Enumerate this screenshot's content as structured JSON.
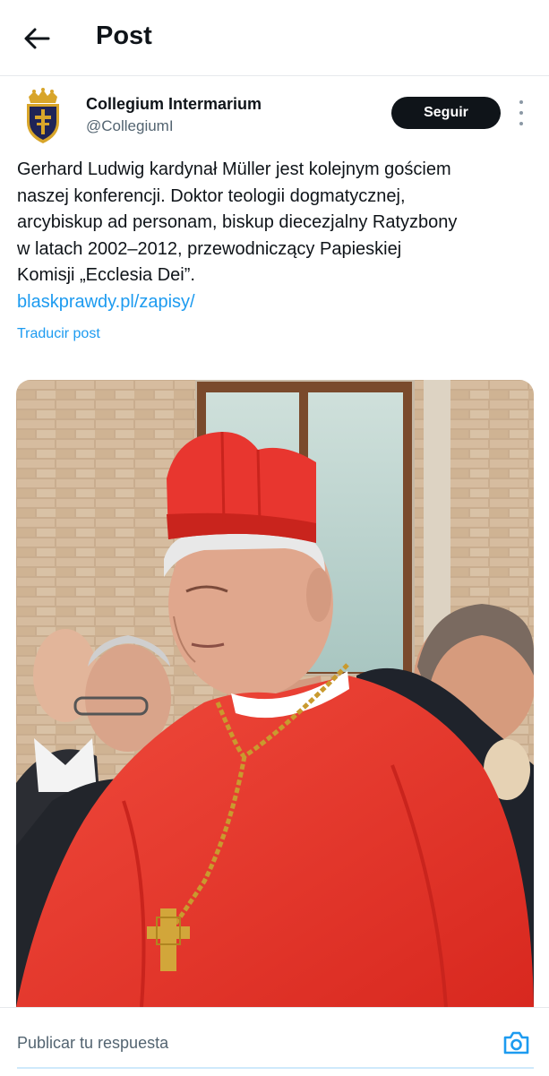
{
  "header": {
    "title": "Post"
  },
  "author": {
    "name": "Collegium Intermarium",
    "handle": "@CollegiumI",
    "follow_label": "Seguir"
  },
  "tweet": {
    "lines": [
      "Gerhard Ludwig kardynał Müller jest kolejnym gościem",
      "naszej konferencji. Doktor teologii dogmatycznej,",
      "arcybiskup ad personam, biskup diecezjalny Ratyzbony",
      "w latach 2002–2012, przewodniczący Papieskiej",
      "Komisji „Ecclesia Dei”."
    ],
    "link": "blaskprawdy.pl/zapisy/",
    "translate_label": "Traducir post"
  },
  "reply": {
    "placeholder": "Publicar tu respuesta"
  },
  "colors": {
    "accent": "#1d9bf0",
    "button": "#0f1419",
    "cardinal_red": "#e8362f"
  },
  "icons": [
    "back-arrow-icon",
    "more-options-icon",
    "camera-icon"
  ]
}
